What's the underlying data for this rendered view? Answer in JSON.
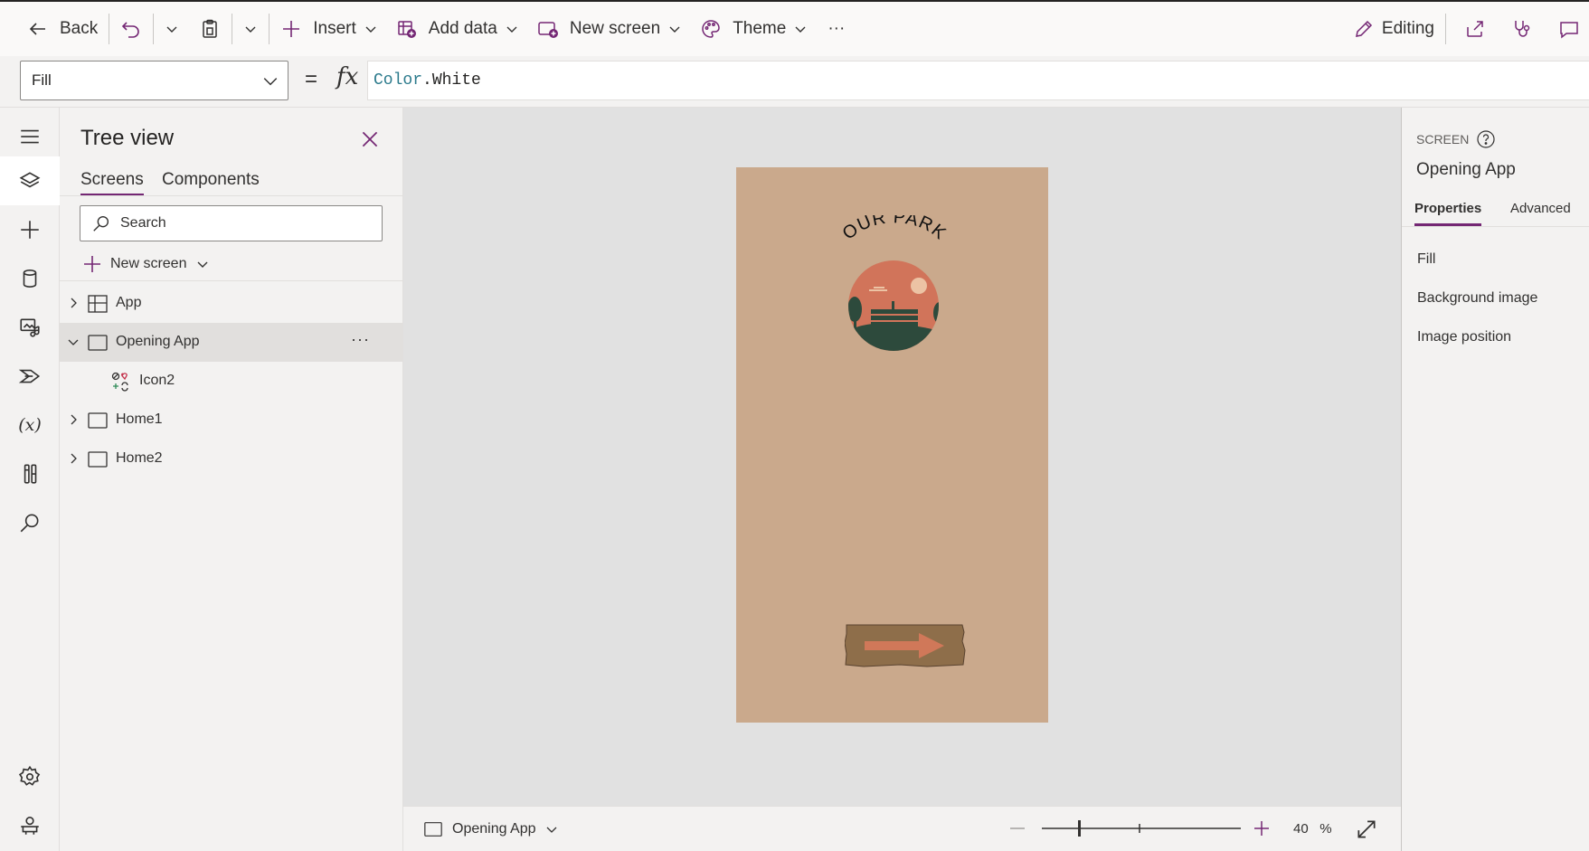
{
  "toolbar": {
    "back_label": "Back",
    "insert_label": "Insert",
    "add_data_label": "Add data",
    "new_screen_label": "New screen",
    "theme_label": "Theme",
    "more_label": "···",
    "editing_label": "Editing"
  },
  "formula_bar": {
    "property": "Fill",
    "equals": "=",
    "fx": "fx",
    "formula_object": "Color",
    "formula_dot_prop": ".White"
  },
  "rail": {
    "icons": [
      "hamburger-menu-icon",
      "layers-icon",
      "plus-icon",
      "database-icon",
      "media-icon",
      "power-automate-icon",
      "variables-icon",
      "tools-icon",
      "search-icon",
      "settings-icon",
      "virtual-agent-icon"
    ],
    "variables_glyph": "(x)"
  },
  "tree": {
    "title": "Tree view",
    "tabs": [
      {
        "label": "Screens",
        "active": true
      },
      {
        "label": "Components",
        "active": false
      }
    ],
    "search_placeholder": "Search",
    "new_screen_label": "New screen",
    "nodes": [
      {
        "label": "App",
        "type": "app",
        "expanded": false
      },
      {
        "label": "Opening App",
        "type": "screen",
        "expanded": true,
        "selected": true,
        "more": "···"
      },
      {
        "label": "Icon2",
        "type": "icon",
        "child": true
      },
      {
        "label": "Home1",
        "type": "screen",
        "expanded": false
      },
      {
        "label": "Home2",
        "type": "screen",
        "expanded": false
      }
    ]
  },
  "canvas": {
    "background": "#e1e1e1",
    "screen_fill": "#caa98c",
    "logo_text": "OUR PARK"
  },
  "statusbar": {
    "screen_name": "Opening App",
    "zoom_value": "40",
    "zoom_unit": "%"
  },
  "properties": {
    "kind": "SCREEN",
    "name": "Opening App",
    "tabs": [
      {
        "label": "Properties",
        "active": true
      },
      {
        "label": "Advanced",
        "active": false
      }
    ],
    "rows": [
      "Fill",
      "Background image",
      "Image position"
    ]
  },
  "colors": {
    "accent": "#742774",
    "text": "#252423"
  }
}
